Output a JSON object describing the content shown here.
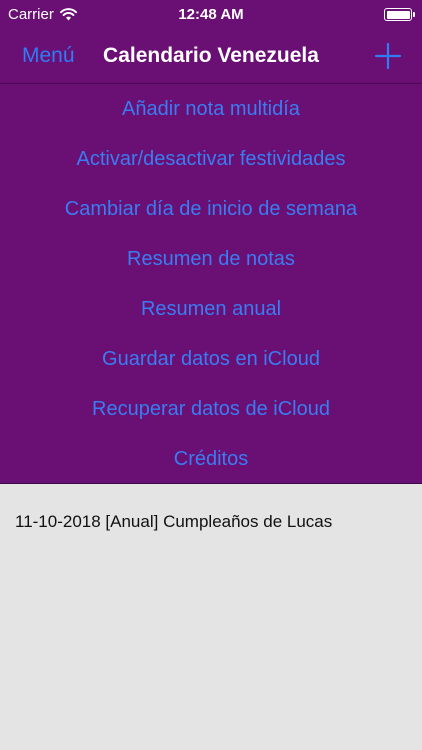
{
  "status_bar": {
    "carrier": "Carrier",
    "time": "12:48 AM"
  },
  "navbar": {
    "menu_label": "Menú",
    "title": "Calendario Venezuela",
    "add_icon": "plus-icon"
  },
  "menu": {
    "items": [
      {
        "label": "Añadir nota multidía"
      },
      {
        "label": "Activar/desactivar festividades"
      },
      {
        "label": "Cambiar día de inicio de semana"
      },
      {
        "label": "Resumen de notas"
      },
      {
        "label": "Resumen anual"
      },
      {
        "label": "Guardar datos en iCloud"
      },
      {
        "label": "Recuperar datos de iCloud"
      },
      {
        "label": "Créditos"
      }
    ]
  },
  "notes": [
    {
      "text": "11-10-2018 [Anual] Cumpleaños de Lucas"
    }
  ],
  "colors": {
    "bar_background": "#6a0f74",
    "accent": "#3a7cf2",
    "content_background": "#e4e4e4"
  }
}
